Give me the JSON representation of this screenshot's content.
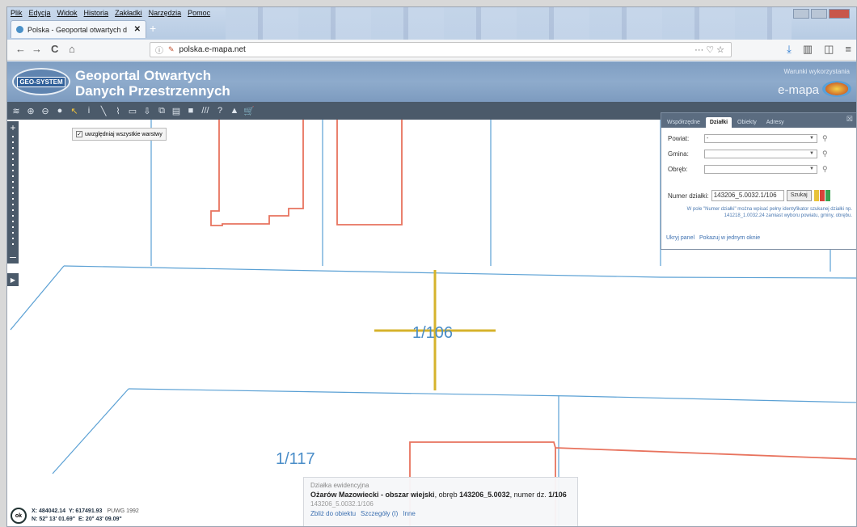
{
  "browser": {
    "menu": [
      "Plik",
      "Edycja",
      "Widok",
      "Historia",
      "Zakładki",
      "Narzędzia",
      "Pomoc"
    ],
    "tab_title": "Polska - Geoportal otwartych d",
    "tab_close": "✕",
    "new_tab": "+",
    "url": "polska.e-mapa.net",
    "nav": {
      "back": "←",
      "forward": "→",
      "reload": "C",
      "home": "⌂"
    },
    "url_actions": "··· ♡ ☆"
  },
  "header": {
    "logo_text": "GEO-SYSTEM",
    "title_line1": "Geoportal Otwartych",
    "title_line2": "Danych Przestrzennych",
    "terms": "Warunki wykorzystania",
    "brand": "e-mapa"
  },
  "toolbar": {
    "tools": [
      "layers-icon",
      "zoom-in-icon",
      "zoom-out-icon",
      "pan-icon",
      "select-icon",
      "info-icon",
      "measure-line-icon",
      "measure-area-icon",
      "print-icon",
      "download-icon",
      "export-icon",
      "legend-icon",
      "bookmark-icon",
      "hatch-icon",
      "help-icon",
      "share-icon",
      "cart-icon"
    ],
    "tool_glyphs": [
      "≋",
      "⊕",
      "⊖",
      "●",
      "↖",
      "i",
      "╲",
      "⌇",
      "▭",
      "⇩",
      "⧉",
      "▤",
      "■",
      "///",
      "?",
      "▲",
      "🛒"
    ]
  },
  "layers_tip": {
    "label": "uwzględniaj wszystkie warstwy",
    "checked": true
  },
  "map": {
    "parcel_main": "1/106",
    "parcel_other": "1/117"
  },
  "panel": {
    "tabs": [
      "Współrzędne",
      "Działki",
      "Obiekty",
      "Adresy"
    ],
    "active_tab": "Działki",
    "close": "☒",
    "powiat_label": "Powiat:",
    "powiat_value": "-",
    "gmina_label": "Gmina:",
    "gmina_value": "",
    "obreb_label": "Obręb:",
    "obreb_value": "",
    "numer_label": "Numer działki:",
    "numer_value": "143206_5.0032.1/106",
    "search_button": "Szukaj",
    "hint": "W pole \"Numer działki\" można wpisać pełny identyfikator szukanej działki np. 141218_1.0032.24 zamiast wyboru powiatu, gminy, obrębu.",
    "links": [
      "Ukryj panel",
      "Pokazuj w jednym oknie"
    ]
  },
  "infobox": {
    "heading": "Działka ewidencyjna",
    "place": "Ożarów Mazowiecki - obszar wiejski",
    "obreb_text": ", obręb ",
    "obreb": "143206_5.0032",
    "numer_text": ", numer dz. ",
    "numer": "1/106",
    "id": "143206_5.0032.1/106",
    "links": [
      "Zbliż do obiektu",
      "Szczegóły (I)",
      "Inne"
    ]
  },
  "coords": {
    "ok": "ok",
    "x": "X: 484042.14",
    "y": "Y: 617491.93",
    "system": "PUWG 1992",
    "n": "N: 52° 13' 01.69\"",
    "e": "E: 20° 43' 09.09\""
  },
  "colors": {
    "parcel_line": "#5aa0d4",
    "building_line": "#e8735e",
    "highlight_cross": "#d6b32c",
    "toolbar": "#4b5a6a",
    "banner": "#8eabcc"
  }
}
